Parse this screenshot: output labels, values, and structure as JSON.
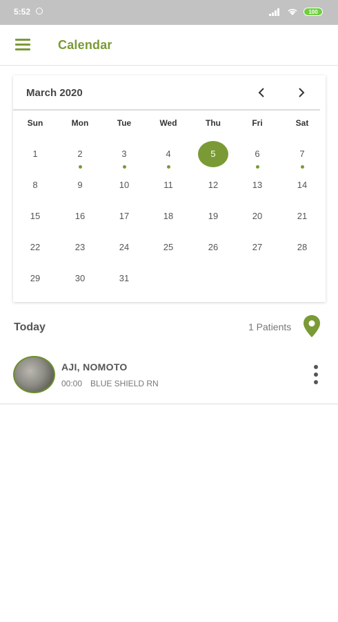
{
  "status_bar": {
    "time": "5:52",
    "battery": "100"
  },
  "app_bar": {
    "title": "Calendar"
  },
  "calendar": {
    "month_label": "March 2020",
    "weekdays": [
      "Sun",
      "Mon",
      "Tue",
      "Wed",
      "Thu",
      "Fri",
      "Sat"
    ],
    "weeks": [
      [
        "1",
        "2",
        "3",
        "4",
        "5",
        "6",
        "7"
      ],
      [
        "8",
        "9",
        "10",
        "11",
        "12",
        "13",
        "14"
      ],
      [
        "15",
        "16",
        "17",
        "18",
        "19",
        "20",
        "21"
      ],
      [
        "22",
        "23",
        "24",
        "25",
        "26",
        "27",
        "28"
      ],
      [
        "29",
        "30",
        "31"
      ]
    ],
    "selected_day": "5",
    "event_days": [
      "2",
      "3",
      "4",
      "6",
      "7"
    ]
  },
  "today": {
    "label": "Today",
    "patients_count": "1 Patients"
  },
  "patients": [
    {
      "name": "AJI, NOMOTO",
      "time": "00:00",
      "plan": "BLUE SHIELD RN"
    }
  ],
  "colors": {
    "accent": "#7a9a35",
    "status_bar": "#c2c2c2"
  }
}
